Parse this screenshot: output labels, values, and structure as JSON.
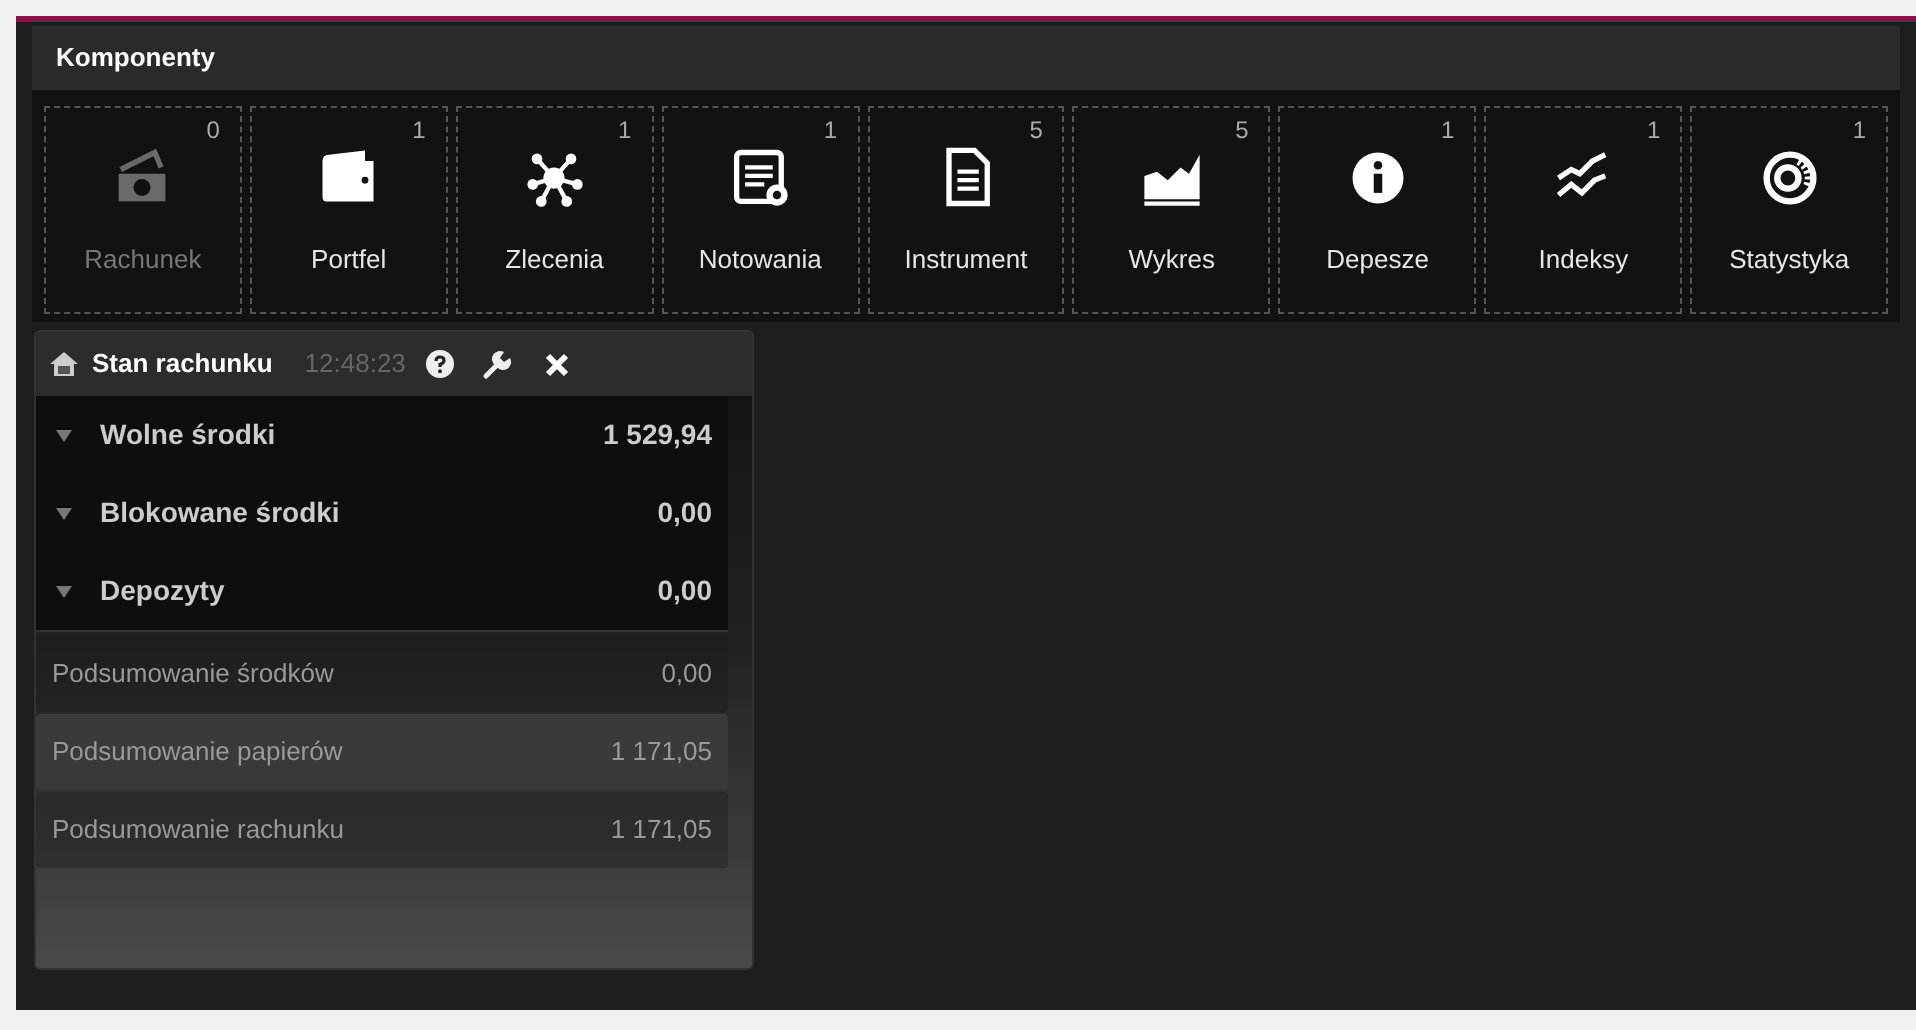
{
  "panel": {
    "title": "Komponenty"
  },
  "tiles": [
    {
      "label": "Rachunek",
      "count": "0",
      "disabled": true
    },
    {
      "label": "Portfel",
      "count": "1",
      "disabled": false
    },
    {
      "label": "Zlecenia",
      "count": "1",
      "disabled": false
    },
    {
      "label": "Notowania",
      "count": "1",
      "disabled": false
    },
    {
      "label": "Instrument",
      "count": "5",
      "disabled": false
    },
    {
      "label": "Wykres",
      "count": "5",
      "disabled": false
    },
    {
      "label": "Depesze",
      "count": "1",
      "disabled": false
    },
    {
      "label": "Indeksy",
      "count": "1",
      "disabled": false
    },
    {
      "label": "Statystyka",
      "count": "1",
      "disabled": false
    }
  ],
  "widget": {
    "title": "Stan rachunku",
    "time": "12:48:23",
    "groups": [
      {
        "label": "Wolne środki",
        "value": "1 529,94",
        "expanded": true
      },
      {
        "label": "Blokowane środki",
        "value": "0,00",
        "expanded": true
      },
      {
        "label": "Depozyty",
        "value": "0,00",
        "expanded": true
      }
    ],
    "summary": [
      {
        "label": "Podsumowanie środków",
        "value": "0,00",
        "selected": false
      },
      {
        "label": "Podsumowanie papierów",
        "value": "1 171,05",
        "selected": true
      },
      {
        "label": "Podsumowanie rachunku",
        "value": "1 171,05",
        "selected": false
      }
    ]
  }
}
